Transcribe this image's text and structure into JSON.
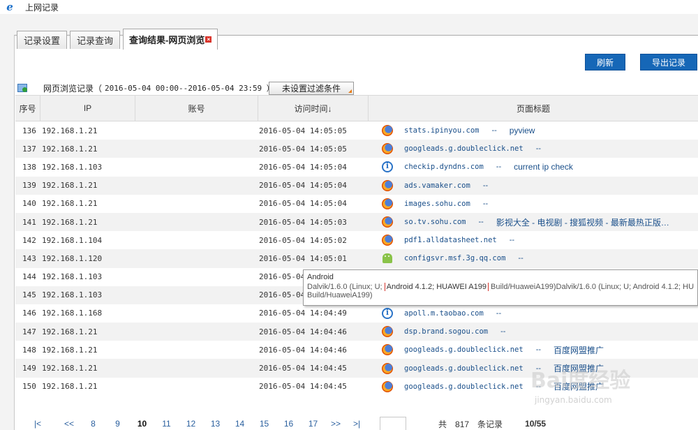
{
  "window": {
    "title": "上网记录"
  },
  "tabs": [
    {
      "label": "记录设置",
      "active": false
    },
    {
      "label": "记录查询",
      "active": false
    },
    {
      "label": "查询结果-网页浏览",
      "active": true
    }
  ],
  "toolbar": {
    "refresh_label": "刷新",
    "export_label": "导出记录"
  },
  "records": {
    "label": "网页浏览记录（",
    "range": "2016-05-04 00:00--2016-05-04 23:59 ）",
    "filter_label": "未设置过滤条件"
  },
  "table": {
    "headers": {
      "no": "序号",
      "ip": "IP",
      "account": "账号",
      "time": "访问时间↓",
      "title": "页面标题"
    },
    "rows": [
      {
        "no": "136",
        "ip": "192.168.1.21",
        "account": "",
        "time": "2016-05-04 14:05:05",
        "browser": "firefox-icon",
        "url": "stats.ipinyou.com",
        "sep": "--",
        "title": "pyview"
      },
      {
        "no": "137",
        "ip": "192.168.1.21",
        "account": "",
        "time": "2016-05-04 14:05:05",
        "browser": "firefox-icon",
        "url": "googleads.g.doubleclick.net",
        "sep": "--",
        "title": ""
      },
      {
        "no": "138",
        "ip": "192.168.1.103",
        "account": "",
        "time": "2016-05-04 14:05:04",
        "browser": "ie-icon",
        "url": "checkip.dyndns.com",
        "sep": "--",
        "title": "current ip check"
      },
      {
        "no": "139",
        "ip": "192.168.1.21",
        "account": "",
        "time": "2016-05-04 14:05:04",
        "browser": "firefox-icon",
        "url": "ads.vamaker.com",
        "sep": "--",
        "title": ""
      },
      {
        "no": "140",
        "ip": "192.168.1.21",
        "account": "",
        "time": "2016-05-04 14:05:04",
        "browser": "firefox-icon",
        "url": "images.sohu.com",
        "sep": "--",
        "title": ""
      },
      {
        "no": "141",
        "ip": "192.168.1.21",
        "account": "",
        "time": "2016-05-04 14:05:03",
        "browser": "firefox-icon",
        "url": "so.tv.sohu.com",
        "sep": "--",
        "title": "影视大全 - 电视剧 - 搜狐视频 - 最新最热正版…"
      },
      {
        "no": "142",
        "ip": "192.168.1.104",
        "account": "",
        "time": "2016-05-04 14:05:02",
        "browser": "firefox-icon",
        "url": "pdf1.alldatasheet.net",
        "sep": "--",
        "title": ""
      },
      {
        "no": "143",
        "ip": "192.168.1.120",
        "account": "",
        "time": "2016-05-04 14:05:01",
        "browser": "android-icon",
        "url": "configsvr.msf.3g.qq.com",
        "sep": "--",
        "title": ""
      },
      {
        "no": "144",
        "ip": "192.168.1.103",
        "account": "",
        "time": "2016-05-04",
        "browser": "",
        "url": "",
        "sep": "",
        "title": ""
      },
      {
        "no": "145",
        "ip": "192.168.1.103",
        "account": "",
        "time": "2016-05-04",
        "browser": "",
        "url": "",
        "sep": "",
        "title": ""
      },
      {
        "no": "146",
        "ip": "192.168.1.168",
        "account": "",
        "time": "2016-05-04 14:04:49",
        "browser": "ie-icon",
        "url": "apoll.m.taobao.com",
        "sep": "--",
        "title": ""
      },
      {
        "no": "147",
        "ip": "192.168.1.21",
        "account": "",
        "time": "2016-05-04 14:04:46",
        "browser": "firefox-icon",
        "url": "dsp.brand.sogou.com",
        "sep": "--",
        "title": ""
      },
      {
        "no": "148",
        "ip": "192.168.1.21",
        "account": "",
        "time": "2016-05-04 14:04:46",
        "browser": "firefox-icon",
        "url": "googleads.g.doubleclick.net",
        "sep": "--",
        "title": "百度网盟推广"
      },
      {
        "no": "149",
        "ip": "192.168.1.21",
        "account": "",
        "time": "2016-05-04 14:04:45",
        "browser": "firefox-icon",
        "url": "googleads.g.doubleclick.net",
        "sep": "--",
        "title": "百度网盟推广"
      },
      {
        "no": "150",
        "ip": "192.168.1.21",
        "account": "",
        "time": "2016-05-04 14:04:45",
        "browser": "firefox-icon",
        "url": "googleads.g.doubleclick.net",
        "sep": "--",
        "title": "百度网盟推广"
      }
    ]
  },
  "tooltip": {
    "title": "Android",
    "line1_pre": "Dalvik/1.6.0 (Linux; U; ",
    "line1_hl": "Android 4.1.2; HUAWEI A199",
    "line1_post": " Build/HuaweiA199)Dalvik/1.6.0 (Linux; U; Android 4.1.2; HUA",
    "line2": "Build/HuaweiA199)"
  },
  "pager": {
    "first": "|<",
    "prev": "<<",
    "pages": [
      "8",
      "9",
      "10",
      "11",
      "12",
      "13",
      "14",
      "15",
      "16",
      "17"
    ],
    "current": "10",
    "next": ">>",
    "last": ">|",
    "total_prefix": "共",
    "total": "817",
    "total_suffix": "条记录",
    "page_count": "10/55"
  },
  "watermark": {
    "text": "Bai度经验",
    "sub": "jingyan.baidu.com"
  }
}
